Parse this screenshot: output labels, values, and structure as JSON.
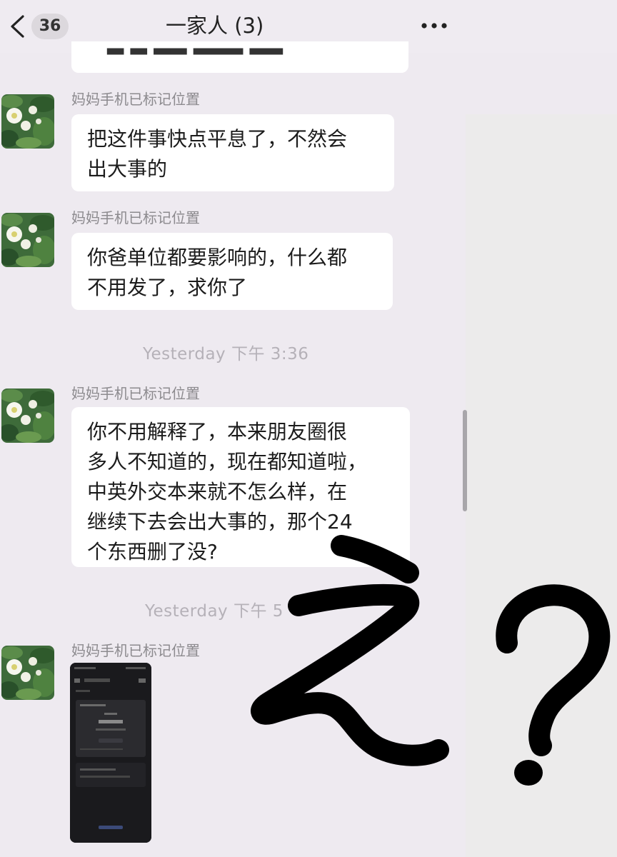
{
  "header": {
    "unread_count": "36",
    "title": "一家人 (3)"
  },
  "messages": [
    {
      "sender": "妈妈手机已标记位置",
      "text": "把这件事快点平息了，不然会\n出大事的"
    },
    {
      "sender": "妈妈手机已标记位置",
      "text": "你爸单位都要影响的，什么都\n不用发了，求你了"
    },
    {
      "sender": "妈妈手机已标记位置",
      "text": "你不用解释了，本来朋友圈很\n多人不知道的，现在都知道啦，\n中英外交本来就不怎么样，在\n继续下去会出大事的，那个24\n个东西删了没?"
    },
    {
      "sender": "妈妈手机已标记位置",
      "attachment": "screenshot-image"
    }
  ],
  "timestamps": [
    "Yesterday 下午 3:36",
    "Yesterday 下午 5"
  ],
  "overlay": {
    "scribble_text": "え?",
    "color": "#000000"
  },
  "colors": {
    "background": "#eeeaf0",
    "bubble": "#ffffff",
    "sender_text": "#8c8a8e",
    "timestamp_text": "#b5b1b8"
  }
}
